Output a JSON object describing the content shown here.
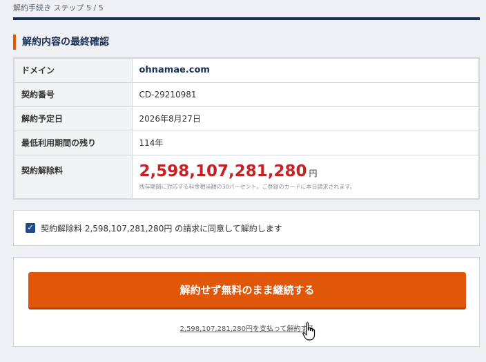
{
  "header": {
    "step_label": "解約手続き ステップ 5 / 5"
  },
  "section": {
    "title": "解約内容の最終確認"
  },
  "details": {
    "rows": [
      {
        "label": "ドメイン",
        "value": "ohnamae.com"
      },
      {
        "label": "契約番号",
        "value": "CD-29210981"
      },
      {
        "label": "解約予定日",
        "value": "2026年8月27日"
      },
      {
        "label": "最低利用期間の残り",
        "value": "114年"
      }
    ],
    "fee": {
      "label": "契約解除料",
      "amount": "2,598,107,281,280",
      "unit": "円",
      "note": "残存期間に対応する料金相当額の30パーセント。ご登録のカードに本日請求されます。"
    }
  },
  "agreement": {
    "checked": true,
    "label": "契約解除料 2,598,107,281,280円 の請求に同意して解約します"
  },
  "actions": {
    "continue_label": "解約せず無料のまま継続する",
    "pay_link": "2,598,107,281,280円を支払って解約する"
  },
  "colors": {
    "accent": "#e0570a",
    "navy": "#1a2f55",
    "fee_red": "#c42225"
  }
}
